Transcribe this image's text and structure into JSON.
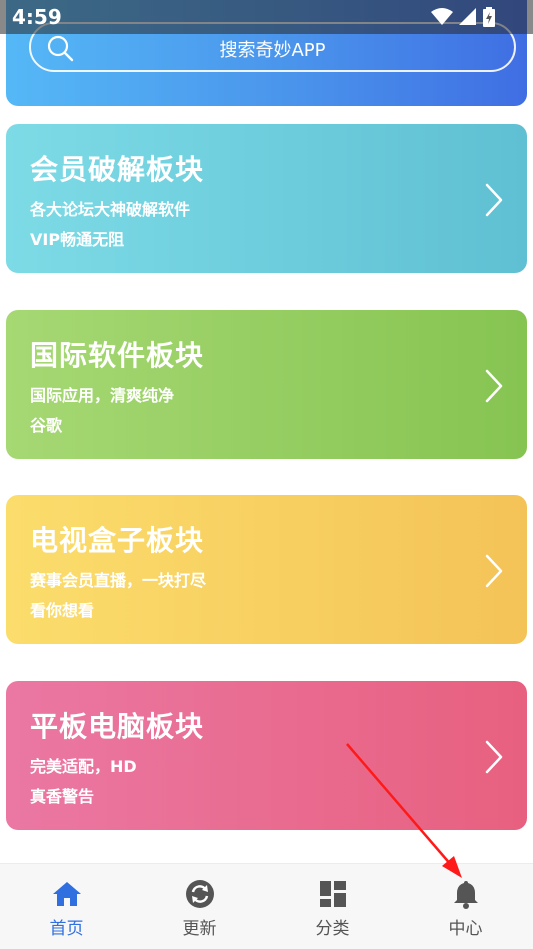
{
  "status_bar": {
    "time": "4:59"
  },
  "search": {
    "text": "搜索奇妙APP"
  },
  "cards": [
    {
      "title": "会员破解板块",
      "line1": "各大论坛大神破解软件",
      "line2": "VIP畅通无阻"
    },
    {
      "title": "国际软件板块",
      "line1": "国际应用，清爽纯净",
      "line2": "谷歌"
    },
    {
      "title": "电视盒子板块",
      "line1": "赛事会员直播，一块打尽",
      "line2": "看你想看"
    },
    {
      "title": "平板电脑板块",
      "line1": "完美适配，HD",
      "line2": "真香警告"
    }
  ],
  "bottom_nav": {
    "items": [
      {
        "label": "首页",
        "icon": "home-icon",
        "active": true
      },
      {
        "label": "更新",
        "icon": "refresh-icon",
        "active": false
      },
      {
        "label": "分类",
        "icon": "grid-icon",
        "active": false
      },
      {
        "label": "中心",
        "icon": "bell-icon",
        "active": false
      }
    ]
  },
  "colors": {
    "active": "#2f6fe0",
    "inactive": "#555555",
    "annotation_arrow": "#ff1a1a"
  }
}
